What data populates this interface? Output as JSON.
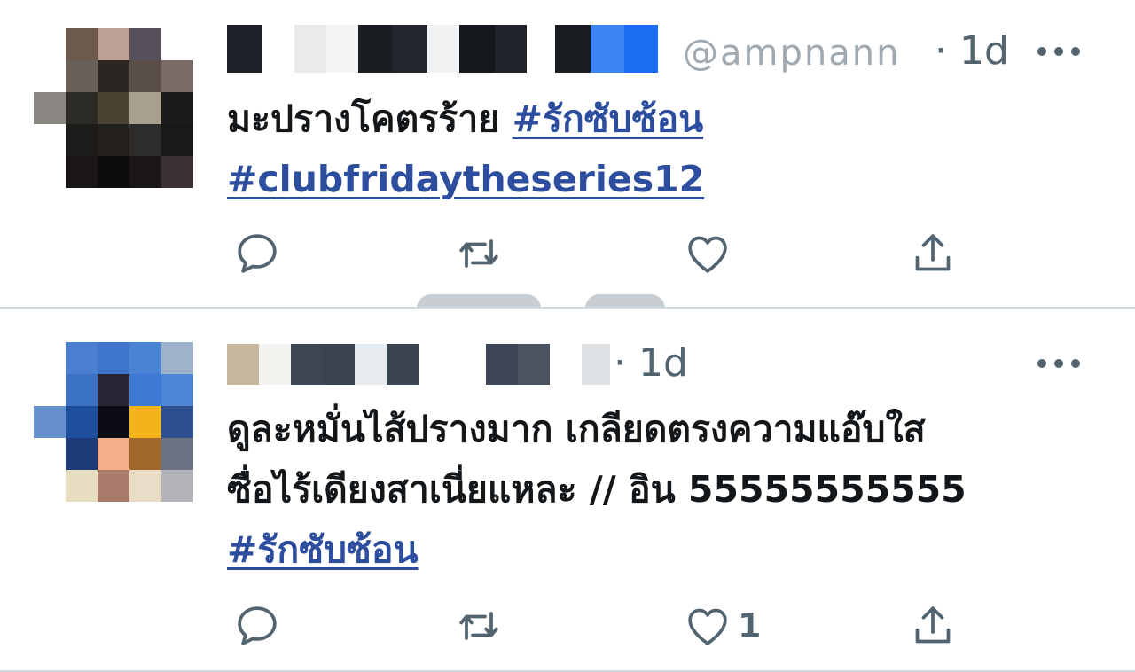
{
  "tweets": [
    {
      "author_redacted": true,
      "handle_fragment": "@ampnann",
      "time": "· 1d",
      "text": "มะปรางโคตรร้าย",
      "hashtags": [
        "#รักซับซ้อน",
        "#clubfridaytheseries12"
      ],
      "actions": {
        "reply": "",
        "retweet": "",
        "like": "",
        "share": ""
      }
    },
    {
      "author_redacted": true,
      "time": "· 1d",
      "text_line1": "ดูละหมั่นไส้ปรางมาก เกลียดตรงความแอ๊บใส",
      "text_line2": "ซื่อไร้เดียงสาเนี่ยแหละ // อิน 55555555555",
      "hashtags": [
        "#รักซับซ้อน"
      ],
      "actions": {
        "reply": "",
        "retweet": "",
        "like": "1",
        "share": ""
      }
    }
  ],
  "icons": {
    "reply": "reply-icon",
    "retweet": "retweet-icon",
    "like": "heart-icon",
    "share": "share-icon",
    "more": "more-icon"
  },
  "colors": {
    "hashtag": "#2d4e9f",
    "muted": "#536471",
    "divider": "#cfd9de"
  }
}
